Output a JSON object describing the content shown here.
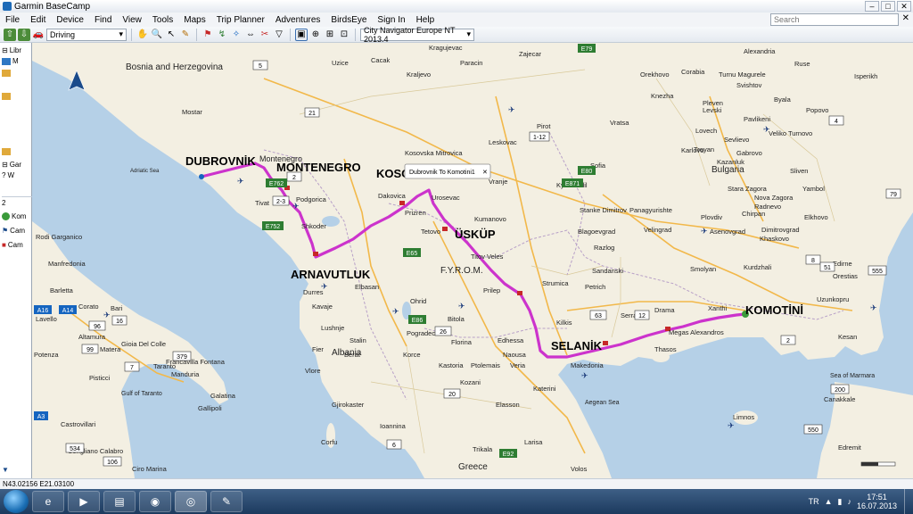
{
  "window": {
    "title": "Garmin BaseCamp",
    "controls": {
      "minimize": "–",
      "maximize": "□",
      "close": "✕"
    }
  },
  "menu": [
    "File",
    "Edit",
    "Device",
    "Find",
    "View",
    "Tools",
    "Maps",
    "Trip Planner",
    "Adventures",
    "BirdsEye",
    "Sign In",
    "Help"
  ],
  "search": {
    "placeholder": "Search",
    "clear": "✕"
  },
  "toolbar": {
    "mode": "Driving",
    "map_product": "City Navigator Europe NT 2013.4",
    "icons": [
      "send-to-device-icon",
      "receive-from-device-icon",
      "car-icon",
      "hand-icon",
      "zoom-icon",
      "select-icon",
      "pencil-icon",
      "waypoint-icon",
      "route-icon",
      "track-icon",
      "measure-icon",
      "erase-icon"
    ]
  },
  "sidebar": {
    "library_label": "Libr",
    "library_sub": "M",
    "garmin_label": "Gar",
    "garmin_sub": "W",
    "items": [
      "Kom",
      "Cam",
      "Cam"
    ]
  },
  "map": {
    "countries": {
      "bosnia": "Bosnia and Herzegovina",
      "montenegro": "Montenegro",
      "albania": "Albania",
      "fyrom": "F.Y.R.O.M.",
      "bulgaria": "Bulgaria",
      "greece": "Greece",
      "aegean": "Aegean Sea",
      "adriatic": "Adriatic Sea",
      "marmara": "Sea of Marmara",
      "taranto": "Gulf of Taranto"
    },
    "route_labels": {
      "dubrovnik": "DUBROVNİK",
      "montenegro": "MONTENEGRO",
      "kosova": "KOSOVA",
      "uskup": "ÜSKÜP",
      "arnavutluk": "ARNAVUTLUK",
      "selanik": "SELANİK",
      "komotini": "KOMOTİNİ"
    },
    "callout": "Dubrovnik To Komotini1",
    "callout_close": "✕",
    "cities": [
      {
        "name": "Uzice"
      },
      {
        "name": "Cacak"
      },
      {
        "name": "Kraljevo"
      },
      {
        "name": "Kragujevac"
      },
      {
        "name": "Paracin"
      },
      {
        "name": "Zajecar"
      },
      {
        "name": "Alexandria"
      },
      {
        "name": "Ruse"
      },
      {
        "name": "Orekhovo"
      },
      {
        "name": "Corabia"
      },
      {
        "name": "Turnu Magurele"
      },
      {
        "name": "Svishtov"
      },
      {
        "name": "Isperikh"
      },
      {
        "name": "Mostar"
      },
      {
        "name": "Knezha"
      },
      {
        "name": "Pleven"
      },
      {
        "name": "Byala"
      },
      {
        "name": "Levski"
      },
      {
        "name": "Popovo"
      },
      {
        "name": "Pavlikeni"
      },
      {
        "name": "Vratsa"
      },
      {
        "name": "Lovech"
      },
      {
        "name": "Sevlievo"
      },
      {
        "name": "Veliko Turnovo"
      },
      {
        "name": "Troyan"
      },
      {
        "name": "Gabrovo"
      },
      {
        "name": "Leskovac"
      },
      {
        "name": "Pirot"
      },
      {
        "name": "Kosovska Mitrovica"
      },
      {
        "name": "Karlovo"
      },
      {
        "name": "Kazanluk"
      },
      {
        "name": "Bulgaria"
      },
      {
        "name": "Sliven"
      },
      {
        "name": "Yambol"
      },
      {
        "name": "Stara Zagora"
      },
      {
        "name": "Radnevo"
      },
      {
        "name": "Nova Zagora"
      },
      {
        "name": "Podgorica"
      },
      {
        "name": "Tivat"
      },
      {
        "name": "Dakovica"
      },
      {
        "name": "Urosevac"
      },
      {
        "name": "Prizren"
      },
      {
        "name": "Kumanovo"
      },
      {
        "name": "Stanke Dimitrov"
      },
      {
        "name": "Panagyurishte"
      },
      {
        "name": "Plovdiv"
      },
      {
        "name": "Chirpan"
      },
      {
        "name": "Elkhovo"
      },
      {
        "name": "Velingrad"
      },
      {
        "name": "Asenovgrad"
      },
      {
        "name": "Dimitrovgrad"
      },
      {
        "name": "Khaskovo"
      },
      {
        "name": "Blagoevgrad"
      },
      {
        "name": "Razlog"
      },
      {
        "name": "Shkoder"
      },
      {
        "name": "Tetovo"
      },
      {
        "name": "Titov Veles"
      },
      {
        "name": "Sandanski"
      },
      {
        "name": "Smolyan"
      },
      {
        "name": "Kurdzhali"
      },
      {
        "name": "Edirne"
      },
      {
        "name": "Orestias"
      },
      {
        "name": "Rodi Garganico"
      },
      {
        "name": "Manfredonia"
      },
      {
        "name": "Barletta"
      },
      {
        "name": "Corato"
      },
      {
        "name": "Bari"
      },
      {
        "name": "Lavello"
      },
      {
        "name": "Altamura"
      },
      {
        "name": "Gioia Del Colle"
      },
      {
        "name": "Matera"
      },
      {
        "name": "Potenza"
      },
      {
        "name": "Taranto"
      },
      {
        "name": "Francavilla Fontana"
      },
      {
        "name": "Manduria"
      },
      {
        "name": "Pisticci"
      },
      {
        "name": "Galatina"
      },
      {
        "name": "Gallipoli"
      },
      {
        "name": "Durres"
      },
      {
        "name": "Kavaje"
      },
      {
        "name": "Elbasan"
      },
      {
        "name": "Lushnje"
      },
      {
        "name": "Ohrid"
      },
      {
        "name": "Bitola"
      },
      {
        "name": "Prilep"
      },
      {
        "name": "Strumica"
      },
      {
        "name": "Petrich"
      },
      {
        "name": "Kilkis"
      },
      {
        "name": "Serrai"
      },
      {
        "name": "Drama"
      },
      {
        "name": "Xanthi"
      },
      {
        "name": "Uzunkopru"
      },
      {
        "name": "Stalin"
      },
      {
        "name": "Pogradec"
      },
      {
        "name": "Florina"
      },
      {
        "name": "Edhessa"
      },
      {
        "name": "Megas Alexandros"
      },
      {
        "name": "Thasos"
      },
      {
        "name": "Kesan"
      },
      {
        "name": "Berat"
      },
      {
        "name": "Fier"
      },
      {
        "name": "Korce"
      },
      {
        "name": "Kastoria"
      },
      {
        "name": "Ptolemais"
      },
      {
        "name": "Naousa"
      },
      {
        "name": "Veria"
      },
      {
        "name": "Makedonia"
      },
      {
        "name": "Katerini"
      },
      {
        "name": "Vlore"
      },
      {
        "name": "Gjirokaster"
      },
      {
        "name": "Kozani"
      },
      {
        "name": "Elasson"
      },
      {
        "name": "Canakkale"
      },
      {
        "name": "Castrovillari"
      },
      {
        "name": "Corigliano Calabro"
      },
      {
        "name": "Ciro Marina"
      },
      {
        "name": "Corfu"
      },
      {
        "name": "Ioannina"
      },
      {
        "name": "Trikala"
      },
      {
        "name": "Larisa"
      },
      {
        "name": "Volos"
      },
      {
        "name": "Greece"
      },
      {
        "name": "Limnos"
      },
      {
        "name": "Edremit"
      },
      {
        "name": "Sofia"
      },
      {
        "name": "Kyustendil"
      },
      {
        "name": "Vranje"
      }
    ],
    "road_shields": [
      "5",
      "21",
      "E79",
      "E80",
      "E871",
      "1-12",
      "2",
      "4",
      "79",
      "E752",
      "E762",
      "2-3",
      "E65",
      "E86",
      "26",
      "63",
      "12",
      "6",
      "E92",
      "20",
      "379",
      "7",
      "99",
      "96",
      "16",
      "A14",
      "A16",
      "A3",
      "534",
      "106",
      "8",
      "51",
      "555",
      "2",
      "200",
      "550"
    ]
  },
  "status": {
    "coords": "N43.02156 E21.03100"
  },
  "taskbar": {
    "lang": "TR",
    "time": "17:51",
    "date": "16.07.2013",
    "icons": [
      "explorer-icon",
      "media-icon",
      "folder-icon",
      "chrome-icon",
      "basecamp-icon",
      "tool-icon"
    ]
  }
}
